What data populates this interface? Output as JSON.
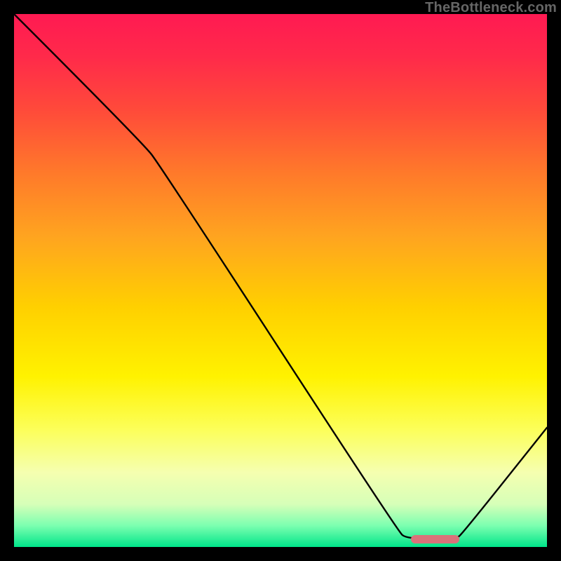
{
  "watermark": "TheBottleneck.com",
  "chart_data": {
    "type": "line",
    "title": "",
    "xlabel": "",
    "ylabel": "",
    "xlim": [
      0,
      100
    ],
    "ylim": [
      0,
      100
    ],
    "background_gradient": {
      "top": "#ff1a52",
      "middle": "#fff200",
      "bottom": "#00e58a"
    },
    "curve_points": [
      {
        "x": 0.0,
        "y": 100.0
      },
      {
        "x": 24.0,
        "y": 76.0
      },
      {
        "x": 27.6,
        "y": 71.3
      },
      {
        "x": 72.0,
        "y": 3.0
      },
      {
        "x": 73.7,
        "y": 1.5
      },
      {
        "x": 82.9,
        "y": 1.5
      },
      {
        "x": 84.2,
        "y": 2.6
      },
      {
        "x": 100.0,
        "y": 22.4
      }
    ],
    "optimum_marker": {
      "x_start": 74.5,
      "x_end": 83.5,
      "y": 1.5,
      "color": "#d9737a"
    }
  }
}
